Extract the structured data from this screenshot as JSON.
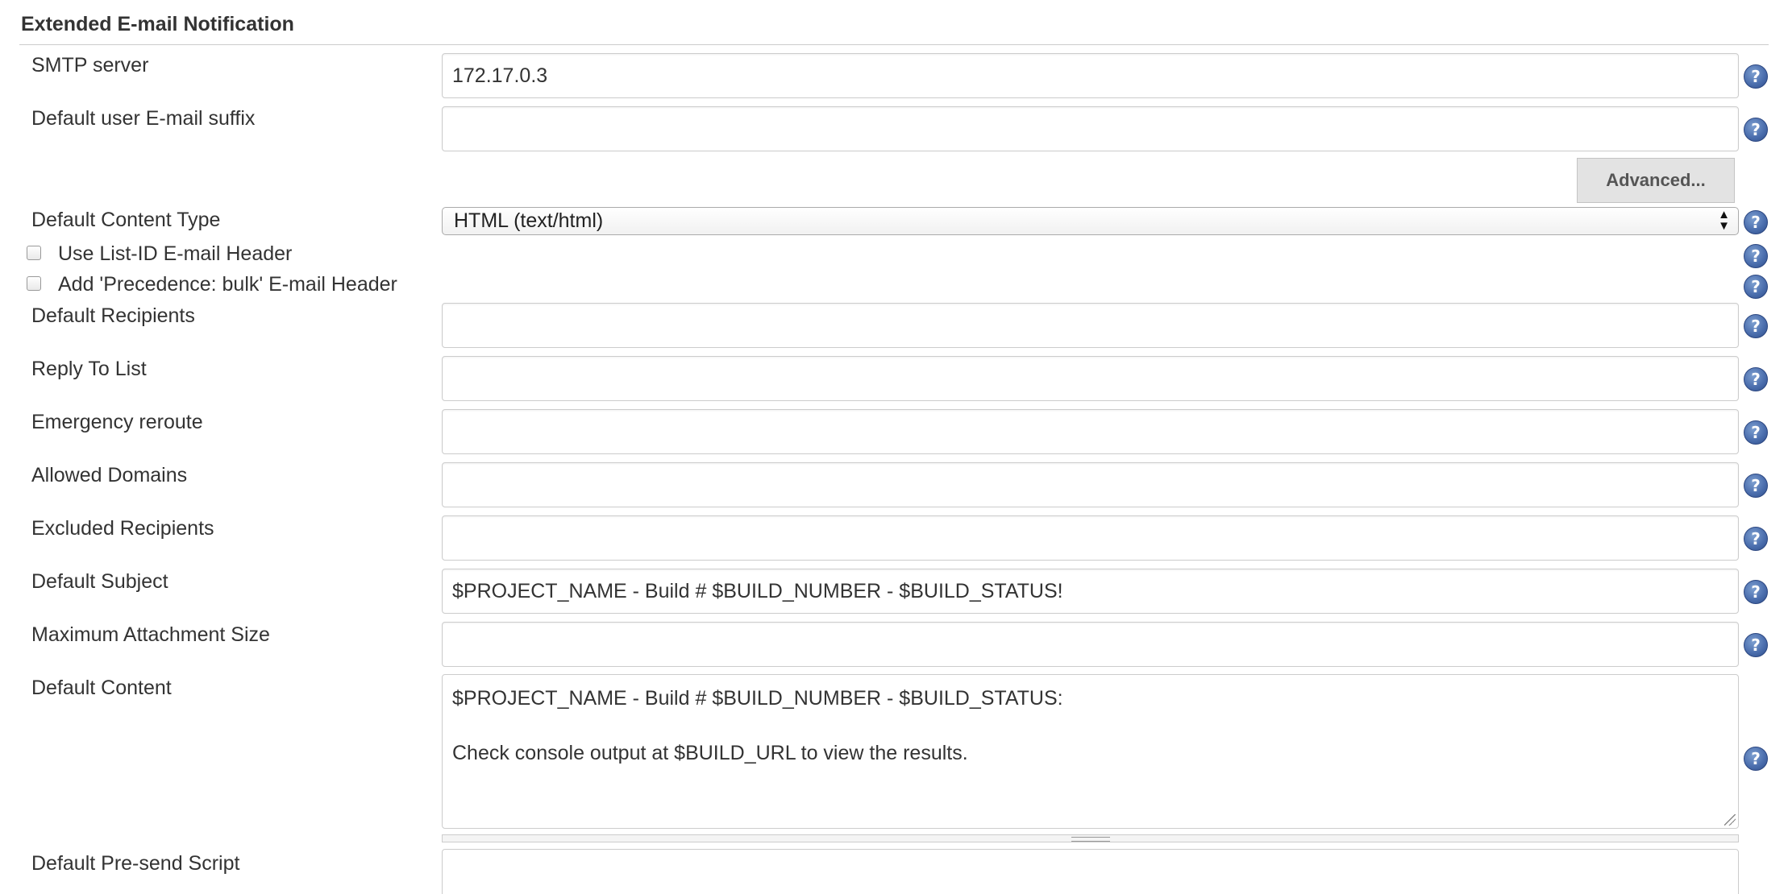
{
  "section": {
    "title": "Extended E-mail Notification"
  },
  "fields": {
    "smtp_server": {
      "label": "SMTP server",
      "value": "172.17.0.3"
    },
    "email_suffix": {
      "label": "Default user E-mail suffix",
      "value": ""
    },
    "advanced_button": "Advanced...",
    "content_type": {
      "label": "Default Content Type",
      "selected": "HTML (text/html)"
    },
    "list_id_header": {
      "label": "Use List-ID E-mail Header",
      "checked": false
    },
    "precedence_header": {
      "label": "Add 'Precedence: bulk' E-mail Header",
      "checked": false
    },
    "default_recipients": {
      "label": "Default Recipients",
      "value": ""
    },
    "reply_to_list": {
      "label": "Reply To List",
      "value": ""
    },
    "emergency_reroute": {
      "label": "Emergency reroute",
      "value": ""
    },
    "allowed_domains": {
      "label": "Allowed Domains",
      "value": ""
    },
    "excluded_recipients": {
      "label": "Excluded Recipients",
      "value": ""
    },
    "default_subject": {
      "label": "Default Subject",
      "value": "$PROJECT_NAME - Build # $BUILD_NUMBER - $BUILD_STATUS!"
    },
    "max_attachment_size": {
      "label": "Maximum Attachment Size",
      "value": ""
    },
    "default_content": {
      "label": "Default Content",
      "lines": [
        "$PROJECT_NAME - Build # $BUILD_NUMBER - $BUILD_STATUS:",
        "",
        "Check console output at $BUILD_URL to view the results."
      ]
    },
    "presend_script": {
      "label": "Default Pre-send Script",
      "value": ""
    }
  },
  "icons": {
    "help": "help-icon",
    "help_glyph": "?",
    "select_arrows": "▲▼",
    "checkbox": "checkbox"
  },
  "colors": {
    "help_icon": "#4c6fae",
    "button_bg": "#e3e3e3",
    "border": "#cccccc"
  }
}
